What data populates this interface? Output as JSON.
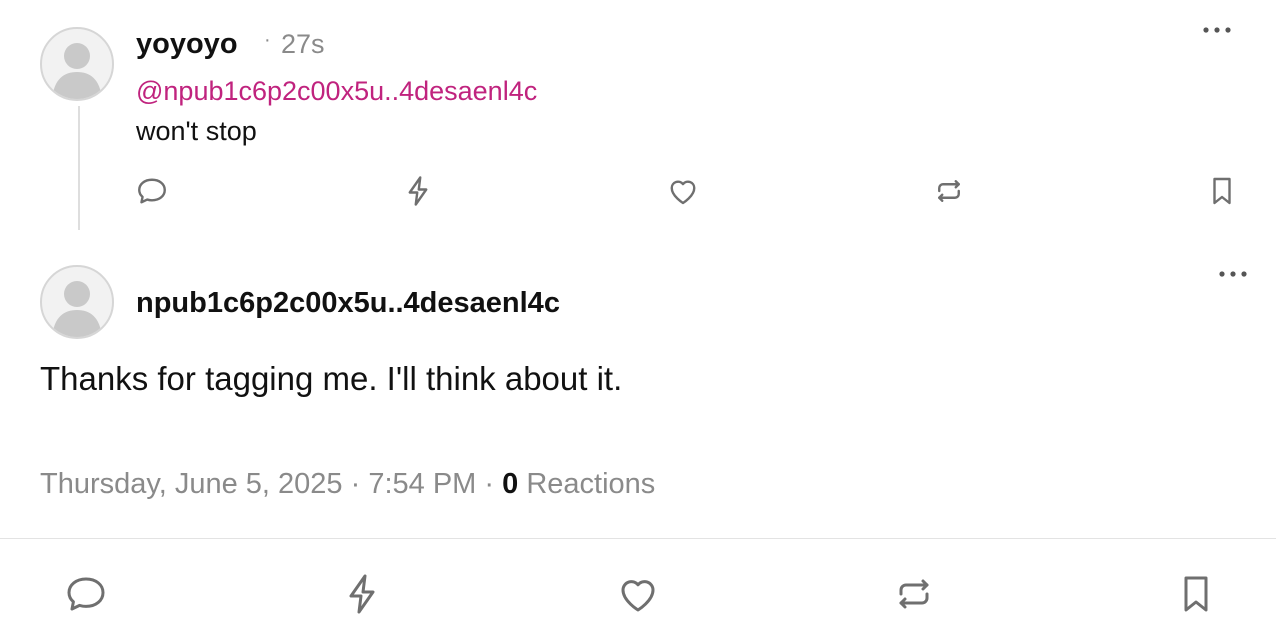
{
  "reply_note": {
    "author": "yoyoyo",
    "time_ago": "27s",
    "mention": "@npub1c6p2c00x5u..4desaenl4c",
    "content": "won't stop",
    "actions": [
      "reply-icon",
      "zap-icon",
      "like-icon",
      "repost-icon",
      "bookmark-icon"
    ]
  },
  "main_note": {
    "author": "npub1c6p2c00x5u..4desaenl4c",
    "content": "Thanks for tagging me. I'll think about it.",
    "date": "Thursday, June 5, 2025",
    "separator": "·",
    "time": "7:54 PM",
    "reactions_count": "0",
    "reactions_label": "Reactions",
    "actions": [
      "reply-icon",
      "zap-icon",
      "like-icon",
      "repost-icon",
      "bookmark-icon"
    ]
  },
  "colors": {
    "mention": "#c0237e",
    "muted": "#8a8a8a",
    "icon": "#6f6f6f"
  }
}
